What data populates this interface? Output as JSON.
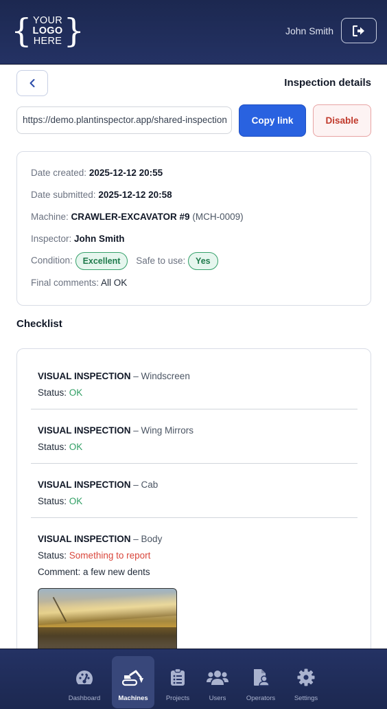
{
  "header": {
    "logo_lines": [
      "YOUR",
      "LOGO",
      "HERE"
    ],
    "user_name": "John Smith",
    "logout_icon": "sign-out-icon"
  },
  "page": {
    "title": "Inspection details",
    "back_icon": "chevron-left-icon"
  },
  "share": {
    "link_value": "https://demo.plantinspector.app/shared-inspection",
    "copy_label": "Copy link",
    "disable_label": "Disable"
  },
  "details": {
    "date_created_label": "Date created:",
    "date_created": "2025-12-12 20:55",
    "date_submitted_label": "Date submitted:",
    "date_submitted": "2025-12-12 20:58",
    "machine_label": "Machine:",
    "machine_name": "CRAWLER-EXCAVATOR #9",
    "machine_id": "(MCH-0009)",
    "inspector_label": "Inspector:",
    "inspector": "John Smith",
    "condition_label": "Condition:",
    "condition": "Excellent",
    "safe_label": "Safe to use:",
    "safe": "Yes",
    "comments_label": "Final comments:",
    "comments": "All OK"
  },
  "checklist": {
    "title": "Checklist",
    "status_label": "Status:",
    "comment_label": "Comment:",
    "items": [
      {
        "category": "VISUAL INSPECTION",
        "name": "Windscreen",
        "status": "OK"
      },
      {
        "category": "VISUAL INSPECTION",
        "name": "Wing Mirrors",
        "status": "OK"
      },
      {
        "category": "VISUAL INSPECTION",
        "name": "Cab",
        "status": "OK"
      },
      {
        "category": "VISUAL INSPECTION",
        "name": "Body",
        "status": "Something to report",
        "comment": "a few new dents"
      }
    ]
  },
  "nav": {
    "items": [
      {
        "label": "Dashboard",
        "icon": "gauge-icon"
      },
      {
        "label": "Machines",
        "icon": "excavator-icon"
      },
      {
        "label": "Projects",
        "icon": "clipboard-list-icon"
      },
      {
        "label": "Users",
        "icon": "users-icon"
      },
      {
        "label": "Operators",
        "icon": "file-user-icon"
      },
      {
        "label": "Settings",
        "icon": "gear-icon"
      }
    ],
    "active": "Machines"
  },
  "colors": {
    "header_bg": "#1c2850",
    "primary": "#2962e0",
    "danger": "#c0392b",
    "ok": "#2f9e63",
    "report": "#d9463b"
  }
}
